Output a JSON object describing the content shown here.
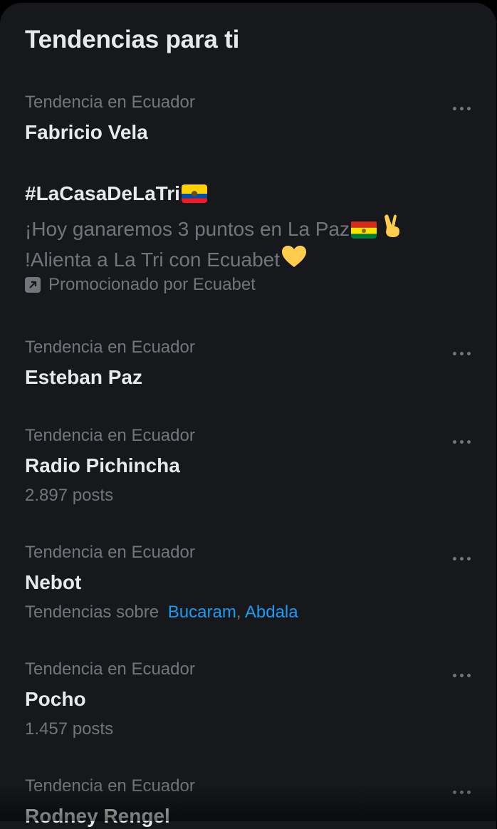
{
  "header": {
    "title": "Tendencias para ti"
  },
  "trends": [
    {
      "meta": "Tendencia en Ecuador",
      "name": "Fabricio Vela"
    },
    {
      "meta": "Tendencia en Ecuador",
      "name": "Esteban Paz"
    },
    {
      "meta": "Tendencia en Ecuador",
      "name": "Radio Pichincha",
      "posts": "2.897 posts"
    },
    {
      "meta": "Tendencia en Ecuador",
      "name": "Nebot",
      "related_prefix": "Tendencias sobre",
      "related": [
        "Bucaram",
        "Abdala"
      ],
      "separator": ","
    },
    {
      "meta": "Tendencia en Ecuador",
      "name": "Pocho",
      "posts": "1.457 posts"
    },
    {
      "meta": "Tendencia en Ecuador",
      "name": "Rodney Rengel"
    }
  ],
  "promoted": {
    "hashtag": "#LaCasaDeLaTri",
    "text_line1": "¡Hoy ganaremos 3 puntos en La Paz",
    "text_line2": "!Alienta a La Tri con Ecuabet",
    "promoted_by": "Promocionado por Ecuabet",
    "icons": [
      "ecuador-flag",
      "bolivia-flag",
      "victory-hand",
      "yellow-heart",
      "promoted-arrow-icon"
    ]
  },
  "colors": {
    "background": "#16181c",
    "primary_text": "#e7e9ea",
    "secondary_text": "#71767b",
    "link": "#1d9bf0"
  }
}
